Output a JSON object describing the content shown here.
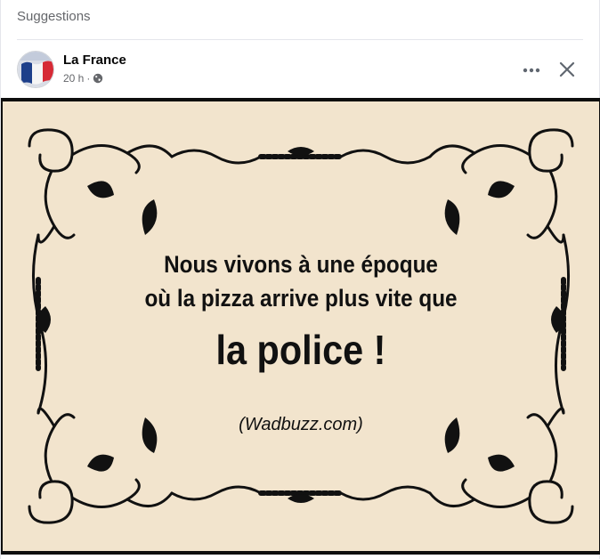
{
  "section": {
    "title": "Suggestions"
  },
  "post": {
    "author": "La France",
    "time": "20 h",
    "separator": "·",
    "visibility_icon": "globe-icon",
    "avatar_icon": "french-flag-avatar",
    "actions": {
      "more_icon": "more-horizontal-icon",
      "close_icon": "close-icon"
    }
  },
  "image": {
    "line1": "Nous vivons à une époque",
    "line2": "où la pizza arrive plus vite que",
    "line3": "la police !",
    "source": "(Wadbuzz.com)",
    "colors": {
      "background": "#f2e4cd",
      "ink": "#111111"
    }
  }
}
